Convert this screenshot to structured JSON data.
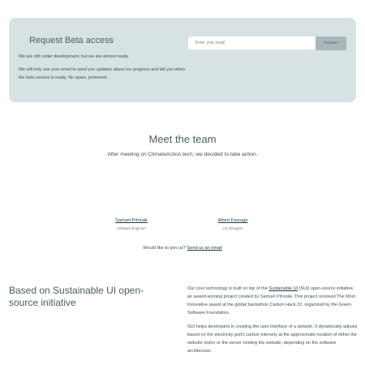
{
  "beta": {
    "title": "Request Beta access",
    "text1": "We are still under development, but we are almost ready.",
    "text2": "We will only use your email to send you updates about our progress and tell you when the beta version is ready. No spam, promised.",
    "email_placeholder": "Enter your email",
    "register_label": "Register"
  },
  "team": {
    "title": "Meet the team",
    "subtitle": "After meeting on ClimateAction.tech, we decided to take action.",
    "members": [
      {
        "name": "Samuel Piťonák",
        "role": "Software Engineer"
      },
      {
        "name": "Albert Fourage",
        "role": "UX Designer"
      }
    ],
    "join_text": "Would like to join us?",
    "join_link": "Send us an email"
  },
  "sui": {
    "heading": "Based on Sustainable UI open-source initiative",
    "p1_before": "Our core technology is built on top of the",
    "p1_link": "Sustainable UI",
    "p1_after": "(SUI) open-source initiative, an award-winning project created by Samuel Piťonák. This project received The Most Innovative award at the global hackathon Carbon Hack 22, organized by the Green Software Foundation.",
    "p2": "SUI helps developers in creating the user interface of a website. It dynamically adjusts based on the electricity grid's carbon intensity at the approximate location of either the website visitor or the server hosting the website, depending on the software architecture."
  }
}
